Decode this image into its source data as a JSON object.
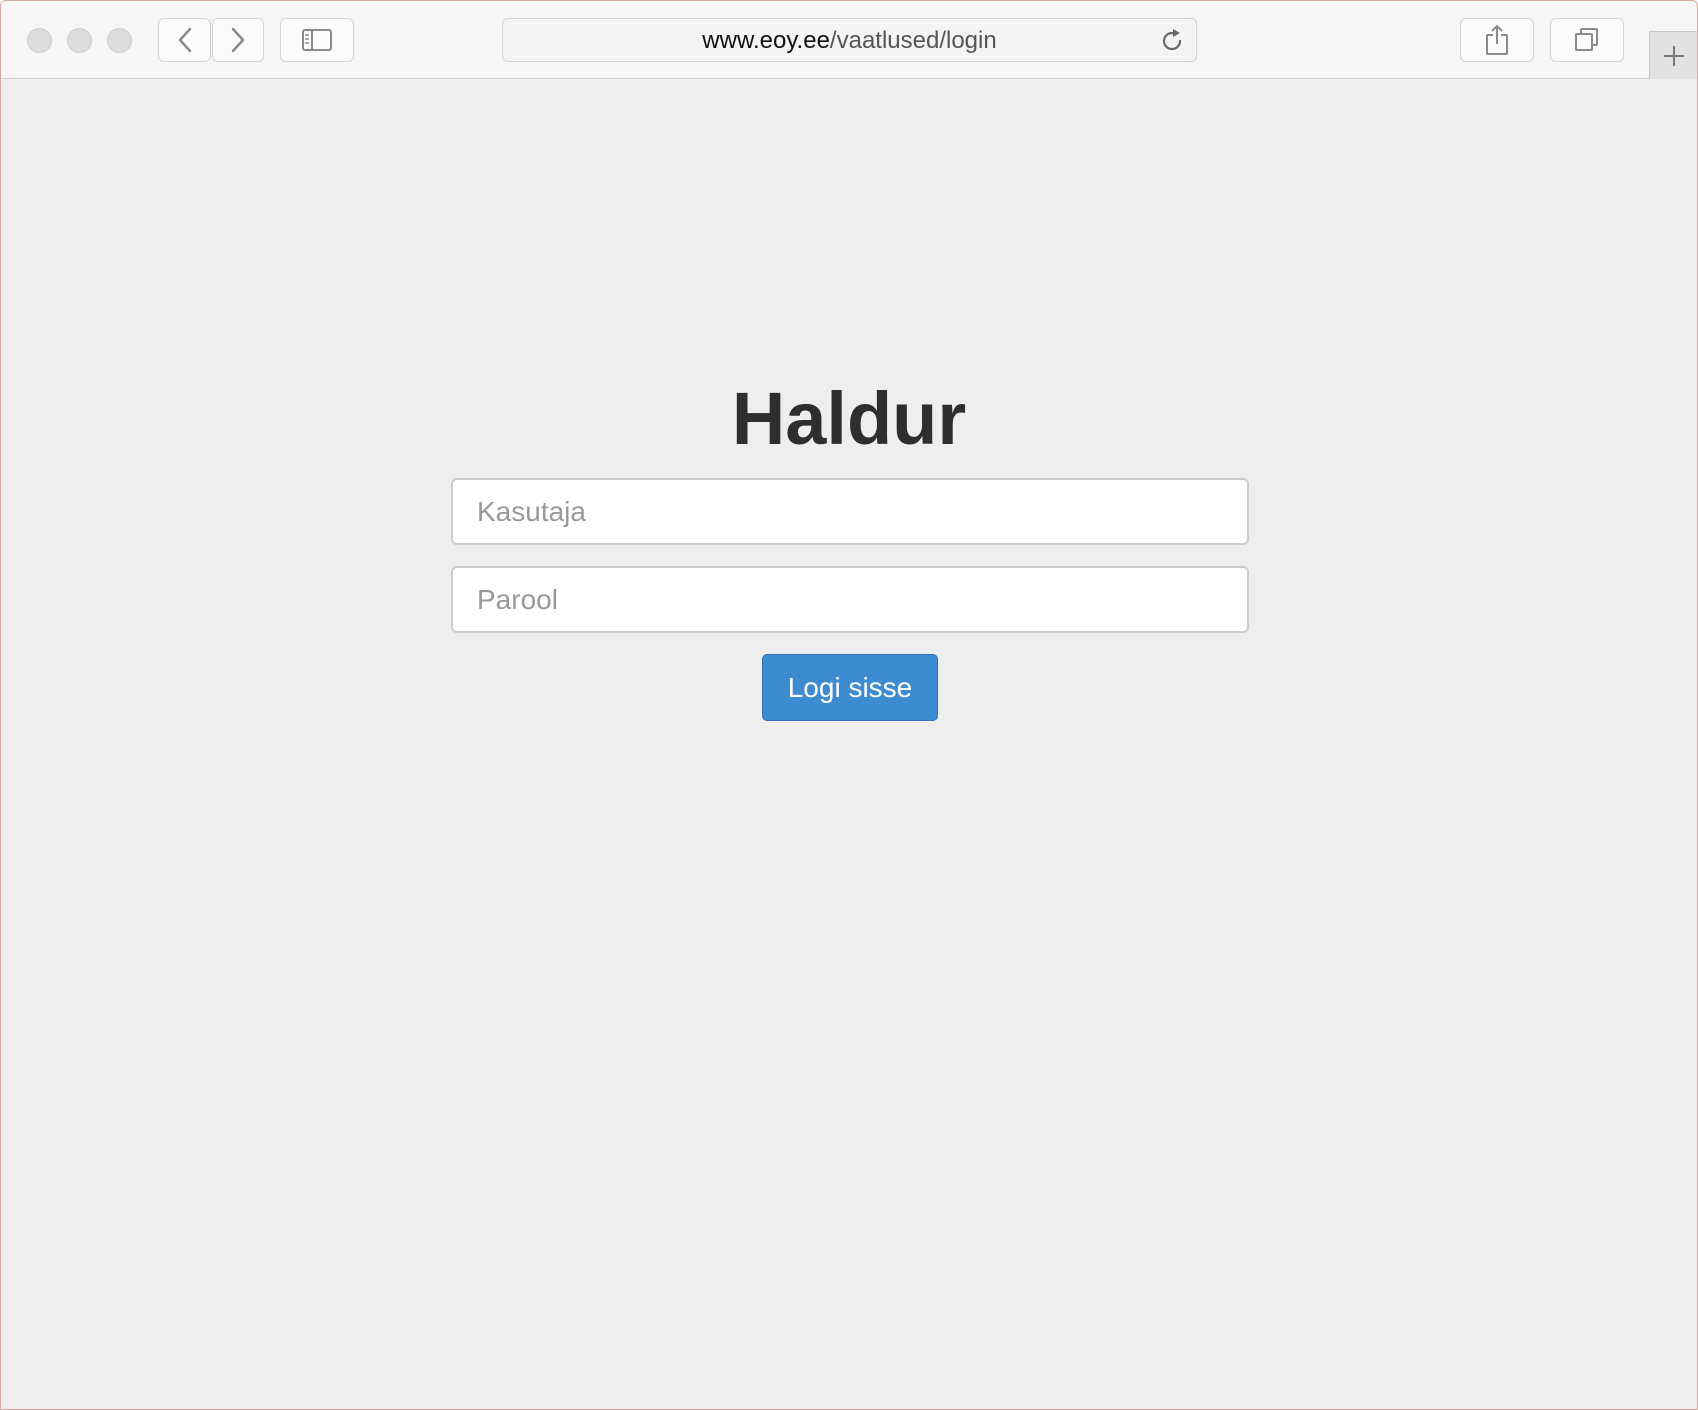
{
  "browser": {
    "url_domain": "www.eoy.ee",
    "url_path": "/vaatlused/login",
    "icons": {
      "back": "chevron-left-icon",
      "forward": "chevron-right-icon",
      "sidebar": "sidebar-icon",
      "reload": "reload-icon",
      "share": "share-icon",
      "tabs": "tabs-icon",
      "new_tab": "plus-icon"
    }
  },
  "login": {
    "title": "Haldur",
    "username_placeholder": "Kasutaja",
    "password_placeholder": "Parool",
    "submit_label": "Logi sisse"
  },
  "colors": {
    "page_background": "#eeeeee",
    "button_primary": "#3d8bd1"
  }
}
